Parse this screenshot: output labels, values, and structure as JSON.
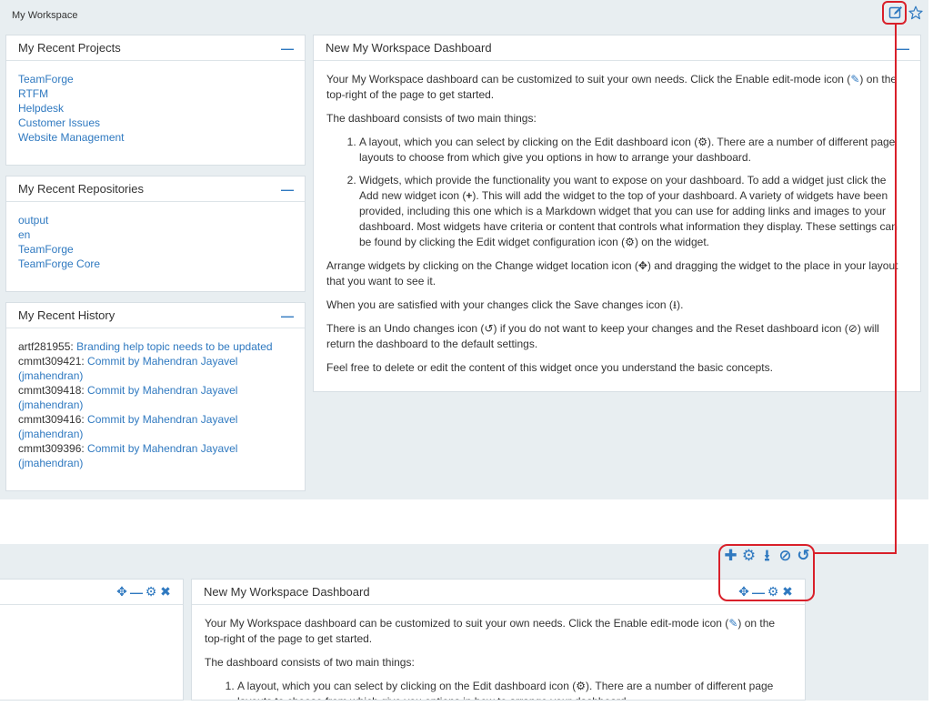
{
  "page": {
    "title": "My Workspace"
  },
  "icons": {
    "edit_mode": "edit-mode-icon",
    "favorite": "star-icon"
  },
  "colors": {
    "accent": "#2f79c0",
    "highlight": "#d9202a",
    "background": "#e8eef1"
  },
  "recent_projects": {
    "title": "My Recent Projects",
    "items": [
      "TeamForge",
      "RTFM",
      "Helpdesk",
      "Customer Issues",
      "Website Management"
    ]
  },
  "recent_repositories": {
    "title": "My Recent Repositories",
    "items": [
      "output",
      "en",
      "TeamForge",
      "TeamForge Core"
    ]
  },
  "recent_history": {
    "title": "My Recent History",
    "items": [
      {
        "id": "artf281955:",
        "text": "Branding help topic needs to be updated"
      },
      {
        "id": "cmmt309421:",
        "text": "Commit by Mahendran Jayavel",
        "text2": "(jmahendran)"
      },
      {
        "id": "cmmt309418:",
        "text": "Commit by Mahendran Jayavel",
        "text2": "(jmahendran)"
      },
      {
        "id": "cmmt309416:",
        "text": "Commit by Mahendran Jayavel",
        "text2": "(jmahendran)"
      },
      {
        "id": "cmmt309396:",
        "text": "Commit by Mahendran Jayavel",
        "text2": "(jmahendran)"
      }
    ]
  },
  "dashboard": {
    "title": "New My Workspace Dashboard",
    "p1a": "Your My Workspace dashboard can be customized to suit your own needs. Click the Enable edit-mode icon (",
    "p1b": ") on the top-right of the page to get started.",
    "p2": "The dashboard consists of two main things:",
    "li1a": "A layout, which you can select by clicking on the Edit dashboard icon (",
    "li1b": "). There are a number of different page layouts to choose from which give you options in how to arrange your dashboard.",
    "li2a": "Widgets, which provide the functionality you want to expose on your dashboard. To add a widget just click the Add new widget icon (",
    "li2b": "). This will add the widget to the top of your dashboard. A variety of widgets have been provided, including this one which is a Markdown widget that you can use for adding links and images to your dashboard. Most widgets have criteria or content that controls what information they display. These settings can be found by clicking the Edit widget configuration icon (",
    "li2c": ") on the widget.",
    "p3a": "Arrange widgets by clicking on the Change widget location icon (",
    "p3b": ") and dragging the widget to the place in your layout that you want to see it.",
    "p4a": "When you are satisfied with your changes click the Save changes icon (",
    "p4b": ").",
    "p5a": "There is an Undo changes icon (",
    "p5b": ") if you do not want to keep your changes and the Reset dashboard icon (",
    "p5c": ") will return the dashboard to the default settings.",
    "p6": "Feel free to delete or edit the content of this widget once you understand the basic concepts."
  },
  "edit_mode": {
    "toolbar": [
      "add-widget-icon",
      "edit-dashboard-icon",
      "save-changes-icon",
      "reset-dashboard-icon",
      "undo-changes-icon"
    ],
    "widget_controls": [
      "move-icon",
      "minimize-icon",
      "configure-icon",
      "close-icon"
    ],
    "dashboard_title": "New My Workspace Dashboard",
    "p1a": "Your My Workspace dashboard can be customized to suit your own needs. Click the Enable edit-mode icon (",
    "p1b": ") on the top-right of the page to get started.",
    "p2": "The dashboard consists of two main things:",
    "li1a": "A layout, which you can select by clicking on the Edit dashboard icon (",
    "li1b": "). There are a number of different page layouts to choose from which give you options in how to arrange your dashboard."
  }
}
